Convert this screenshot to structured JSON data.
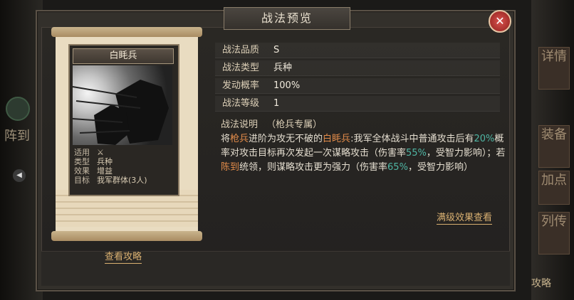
{
  "background": {
    "left_tab_top": "",
    "left_tab_main": "阵到",
    "right_tabs": [
      "详情",
      "装备",
      "加点",
      "列传"
    ],
    "right_bottom": "攻略"
  },
  "window": {
    "title": "战法预览",
    "close_icon": "close-icon"
  },
  "card": {
    "name": "白眊兵",
    "rows": [
      {
        "key": "适用",
        "value": ""
      },
      {
        "key": "类型",
        "value": "兵种"
      },
      {
        "key": "效果",
        "value": "增益"
      },
      {
        "key": "目标",
        "value": "我军群体(3人)"
      }
    ]
  },
  "info": {
    "rows": [
      {
        "label": "战法品质",
        "value": "S"
      },
      {
        "label": "战法类型",
        "value": "兵种"
      },
      {
        "label": "发动概率",
        "value": "100%"
      },
      {
        "label": "战法等级",
        "value": "1"
      }
    ]
  },
  "description": {
    "header_label": "战法说明",
    "header_note": "（枪兵专属）",
    "p1": "将",
    "p2": "枪兵",
    "p3": "进阶为攻无不破的",
    "p4": "白眊兵",
    "p5": ":我军全体战斗中普通攻击后有",
    "p6": "20%",
    "p7": "概率对攻击目标再次发起一次谋略攻击（伤害率",
    "p8": "55%",
    "p9": "，受智力影响）；若",
    "p10": "陈到",
    "p11": "统领，则谋略攻击更为强力（伤害率",
    "p12": "65%",
    "p13": "，受智力影响）"
  },
  "links": {
    "max_effect": "满级效果查看",
    "guide": "查看攻略"
  },
  "colors": {
    "accent": "#e38c4a",
    "teal": "#4fb6a4",
    "link": "#d9b071"
  }
}
